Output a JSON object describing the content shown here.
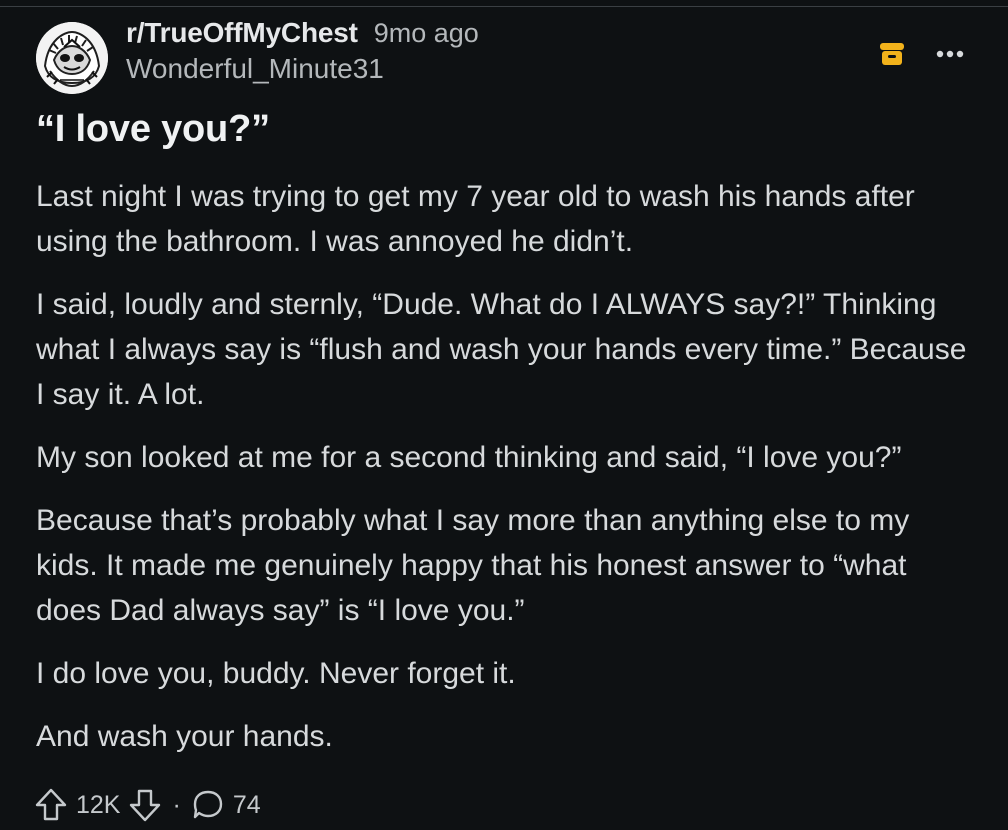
{
  "post": {
    "subreddit": "r/TrueOffMyChest",
    "time_ago": "9mo ago",
    "author": "Wonderful_Minute31",
    "title": "“I love you?”",
    "body": [
      "Last night I was trying to get my 7 year old to wash his hands after using the bathroom. I was annoyed he didn’t.",
      "I said, loudly and sternly, “Dude. What do I ALWAYS say?!” Thinking what I always say is “flush and wash your hands every time.” Because I say it. A lot.",
      "My son looked at me for a second thinking and said, “I love you?”",
      "Because that’s probably what I say more than anything else to my kids. It made me genuinely happy that his honest answer to “what does Dad always say” is “I love you.”",
      "I do love you, buddy. Never forget it.",
      "And wash your hands."
    ]
  },
  "footer": {
    "upvote_count": "12K",
    "separator": "·",
    "comment_count": "74"
  },
  "icons": {
    "avatar": "avatar-image",
    "archive": "archive-icon",
    "more": "more-options-icon",
    "upvote": "upvote-arrow-icon",
    "downvote": "downvote-arrow-icon",
    "comment": "comment-bubble-icon"
  },
  "colors": {
    "background": "#0e1113",
    "text": "#d7dadc",
    "muted": "#b4b8bb",
    "archive_accent": "#f2b21b"
  }
}
